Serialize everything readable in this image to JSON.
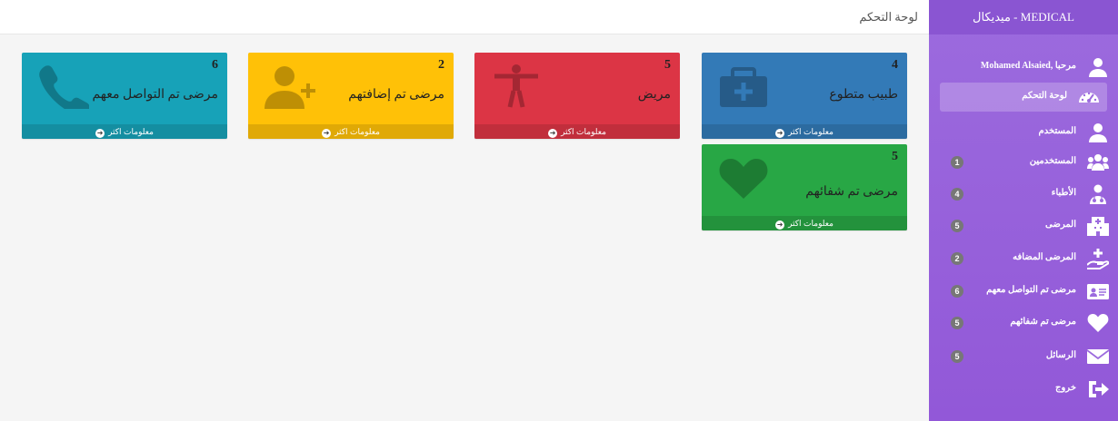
{
  "header": {
    "title": "لوحة التحكم"
  },
  "sidebar": {
    "brand": "MEDICAL - ميديكال",
    "items": [
      {
        "label": "مرحبا ,Mohamed Alsaied",
        "icon": "user-icon",
        "badge": ""
      },
      {
        "label": "لوحة التحكم",
        "icon": "dashboard-gauge-icon",
        "badge": ""
      },
      {
        "label": "المستخدم",
        "icon": "user-icon",
        "badge": ""
      },
      {
        "label": "المستخدمين",
        "icon": "users-group-icon",
        "badge": "1"
      },
      {
        "label": "الأطباء",
        "icon": "doctor-icon",
        "badge": "4"
      },
      {
        "label": "المرضى",
        "icon": "hospital-icon",
        "badge": "5"
      },
      {
        "label": "المرضى المضافه",
        "icon": "hand-plus-icon",
        "badge": "2"
      },
      {
        "label": "مرضى تم التواصل معهم",
        "icon": "id-card-icon",
        "badge": "6"
      },
      {
        "label": "مرضى تم شفائهم",
        "icon": "heart-icon",
        "badge": "5"
      },
      {
        "label": "الرسائل",
        "icon": "envelope-icon",
        "badge": "5"
      },
      {
        "label": "خروج",
        "icon": "sign-out-icon",
        "badge": ""
      }
    ]
  },
  "cards": [
    {
      "count": "4",
      "label": "طبيب متطوع",
      "footer": "معلومات اكثر",
      "color": "#337ab7",
      "icon": "medkit-icon"
    },
    {
      "count": "5",
      "label": "مريض",
      "footer": "معلومات اكثر",
      "color": "#dc3545",
      "icon": "person-icon"
    },
    {
      "count": "2",
      "label": "مرضى تم إضافتهم",
      "footer": "معلومات اكثر",
      "color": "#ffc107",
      "icon": "user-plus-icon"
    },
    {
      "count": "6",
      "label": "مرضى تم التواصل معهم",
      "footer": "معلومات اكثر",
      "color": "#17a2b8",
      "icon": "phone-icon"
    },
    {
      "count": "5",
      "label": "مرضى تم شفائهم",
      "footer": "معلومات اكثر",
      "color": "#28a745",
      "icon": "heart-icon"
    }
  ]
}
